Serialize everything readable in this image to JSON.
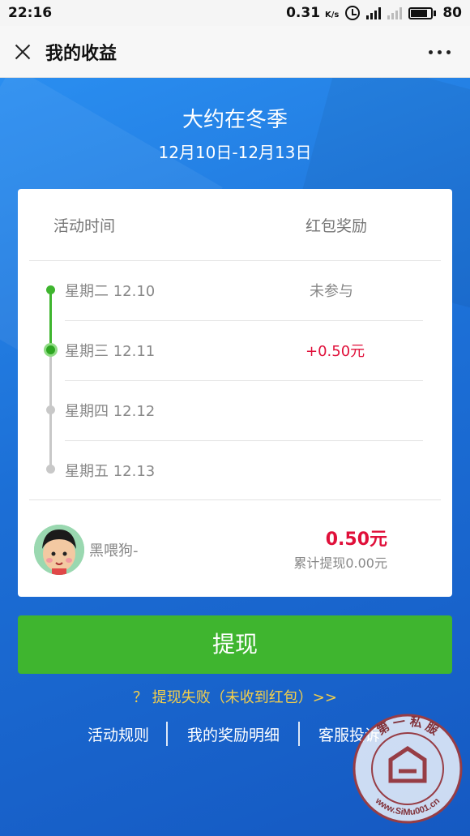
{
  "status_bar": {
    "time": "22:16",
    "net_speed": "0.31",
    "net_unit": "K/s",
    "battery": "80"
  },
  "title_bar": {
    "title": "我的收益"
  },
  "event": {
    "title": "大约在冬季",
    "dates": "12月10日-12月13日"
  },
  "table": {
    "col_time": "活动时间",
    "col_reward": "红包奖励",
    "rows": [
      {
        "date": "星期二 12.10",
        "reward": "未参与"
      },
      {
        "date": "星期三 12.11",
        "reward": "+0.50元"
      },
      {
        "date": "星期四 12.12",
        "reward": ""
      },
      {
        "date": "星期五 12.13",
        "reward": ""
      }
    ]
  },
  "user": {
    "nickname": "黑喂狗-",
    "total": "0.50元",
    "cumulative": "累计提现0.00元"
  },
  "withdraw_button": "提现",
  "fail_link": "？ 提现失败（未收到红包）>>",
  "links": {
    "rules": "活动规则",
    "details": "我的奖励明细",
    "complaint": "客服投诉"
  },
  "watermark": {
    "text": "第 一 私 服",
    "url": "www.SiMu001.cn"
  },
  "colors": {
    "accent_green": "#3fb52f",
    "reward_red": "#e0103a",
    "link_yellow": "#f4cf4a",
    "bg_blue": "#1d6fd8"
  }
}
